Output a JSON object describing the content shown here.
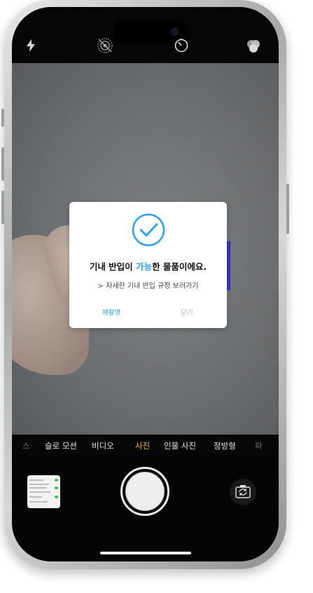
{
  "top_bar": {
    "icons": [
      "flash-icon",
      "live-photo-off-icon",
      "timer-icon",
      "filters-icon"
    ]
  },
  "dialog": {
    "title_pre": "기내 반입이 ",
    "title_highlight": "가능",
    "title_post": "한 물품이에요.",
    "link_arrow": ">",
    "link_text": "자세한 기내 반입 규정 보러가기",
    "retake_label": "재촬영",
    "close_label": "닫기",
    "accent_color": "#2aa3ee"
  },
  "modes": {
    "items": [
      {
        "label": "스",
        "state": "faded"
      },
      {
        "label": "슬로 모션",
        "state": "normal"
      },
      {
        "label": "비디오",
        "state": "normal"
      },
      {
        "label": "사진",
        "state": "active"
      },
      {
        "label": "인물 사진",
        "state": "normal"
      },
      {
        "label": "정방형",
        "state": "normal"
      },
      {
        "label": "파",
        "state": "faded"
      }
    ],
    "active_color": "#f3c230"
  }
}
